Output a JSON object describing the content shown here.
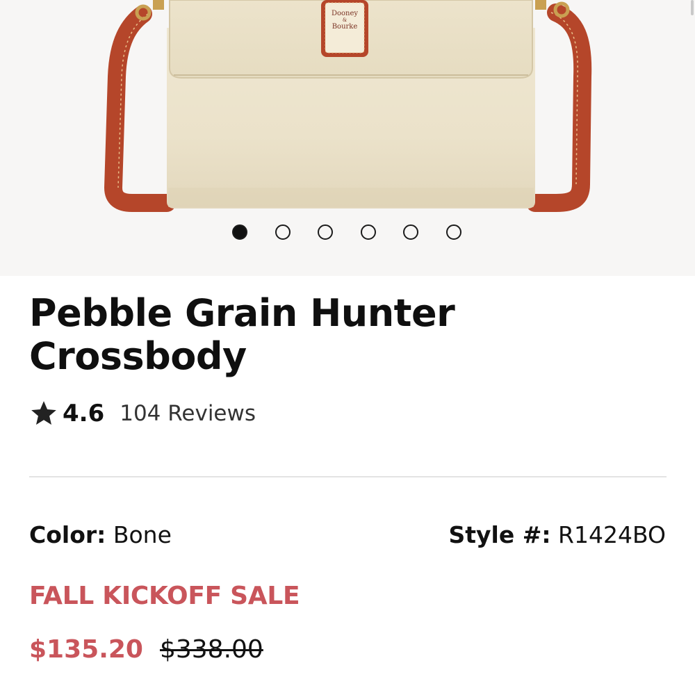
{
  "gallery": {
    "brand_label_line1": "Dooney",
    "brand_label_line2": "&",
    "brand_label_line3": "Bourke",
    "total_images": 6,
    "active_index": 0
  },
  "product": {
    "title": "Pebble Grain Hunter Crossbody",
    "rating": "4.6",
    "reviews": "104 Reviews",
    "color_label": "Color:",
    "color_value": "Bone",
    "style_label": "Style #:",
    "style_value": "R1424BO",
    "sale_label": "FALL KICKOFF SALE",
    "sale_price": "$135.20",
    "original_price": "$338.00"
  },
  "icons": {
    "rating": "star-icon"
  },
  "colors": {
    "sale_accent": "#c9555b",
    "bag_body": "#ece3cc",
    "strap": "#b8482b"
  }
}
